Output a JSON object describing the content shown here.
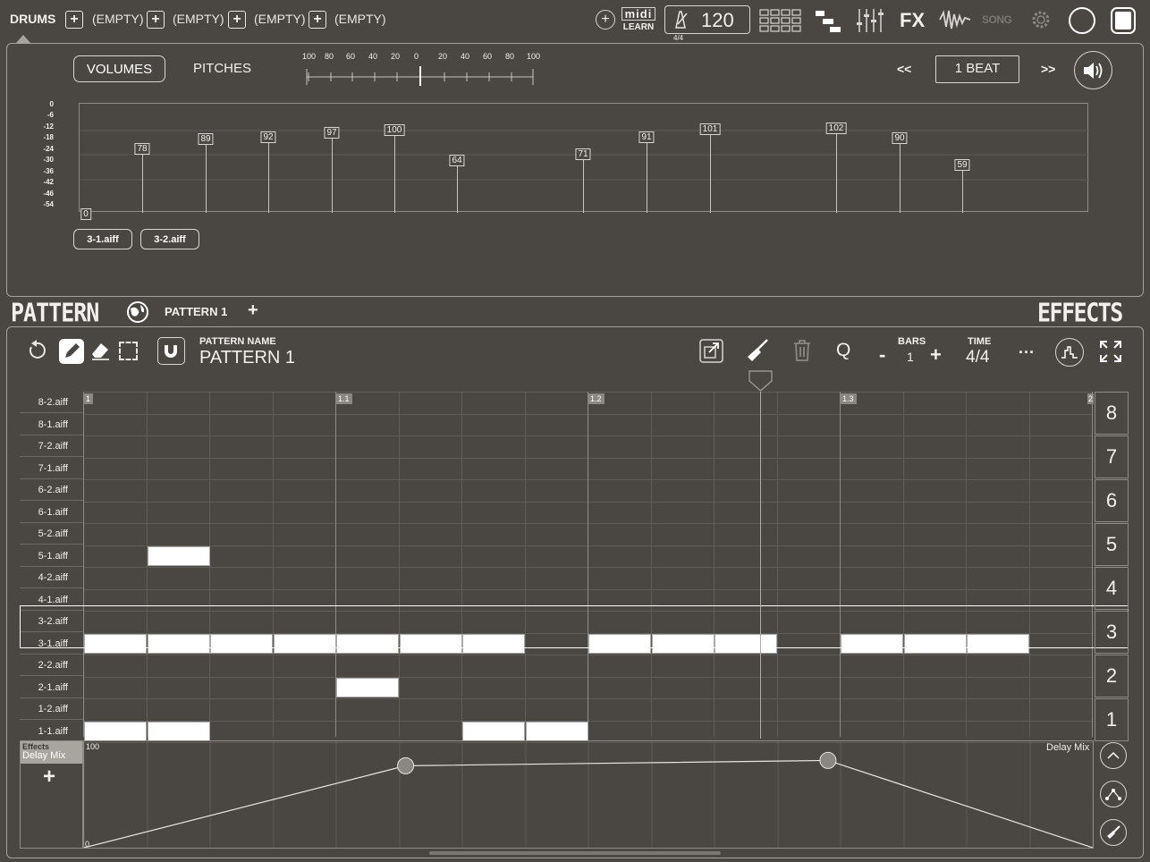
{
  "topbar": {
    "title": "DRUMS",
    "slots": [
      {
        "label": "(EMPTY)"
      },
      {
        "label": "(EMPTY)"
      },
      {
        "label": "(EMPTY)"
      },
      {
        "label": "(EMPTY)"
      }
    ],
    "midi_label": "midi",
    "learn_label": "LEARN",
    "tempo": "120",
    "time_sig_small": "4/4",
    "fx_label": "FX",
    "song_label": "SONG"
  },
  "upper_panel": {
    "tabs": [
      {
        "label": "VOLUMES"
      },
      {
        "label": "PITCHES"
      }
    ],
    "pitch_scale": [
      "100",
      "80",
      "60",
      "40",
      "20",
      "0",
      "20",
      "40",
      "60",
      "80",
      "100"
    ],
    "prev_label": "<<",
    "beat_label": "1 BEAT",
    "next_label": ">>",
    "db_ticks": [
      "0",
      "-6",
      "-12",
      "-18",
      "-24",
      "-30",
      "-36",
      "-42",
      "-46",
      "-54"
    ],
    "velocities": [
      "0",
      "78",
      "89",
      "92",
      "97",
      "100",
      "64",
      "71",
      "91",
      "101",
      "102",
      "90",
      "59"
    ],
    "samples": [
      {
        "label": "3-1.aiff"
      },
      {
        "label": "3-2.aiff"
      }
    ]
  },
  "pattern_header": {
    "title": "PATTERN",
    "pattern": "PATTERN 1",
    "effects_title": "EFFECTS"
  },
  "editor": {
    "name_caption": "PATTERN NAME",
    "name_value": "PATTERN 1",
    "bars_caption": "BARS",
    "bars_value": "1",
    "bars_minus": "-",
    "bars_plus": "+",
    "time_caption": "TIME",
    "time_value": "4/4",
    "more": "···",
    "quantize": "Q"
  },
  "grid": {
    "rows": [
      "8-2.aiff",
      "8-1.aiff",
      "7-2.aiff",
      "7-1.aiff",
      "6-2.aiff",
      "6-1.aiff",
      "5-2.aiff",
      "5-1.aiff",
      "4-2.aiff",
      "4-1.aiff",
      "3-2.aiff",
      "3-1.aiff",
      "2-2.aiff",
      "2-1.aiff",
      "1-2.aiff",
      "1-1.aiff"
    ],
    "markers": [
      "1",
      "1.1",
      "1.2",
      "1.3",
      "2"
    ],
    "pads": [
      "8",
      "7",
      "6",
      "5",
      "4",
      "3",
      "2",
      "1"
    ],
    "notes": [
      {
        "row": "5-1.aiff",
        "steps": [
          2
        ]
      },
      {
        "row": "3-1.aiff",
        "steps": [
          1,
          2,
          3,
          4,
          5,
          6,
          7,
          9,
          10,
          11,
          13,
          14,
          15
        ]
      },
      {
        "row": "2-1.aiff",
        "steps": [
          5
        ]
      },
      {
        "row": "1-1.aiff",
        "steps": [
          1,
          2,
          7,
          8
        ]
      }
    ]
  },
  "automation": {
    "effects_caption": "Effects",
    "param": "Delay Mix",
    "add": "+",
    "top_value": "100",
    "bottom_value": "0",
    "param_right": "Delay Mix",
    "points": [
      {
        "step": 0,
        "value": 0
      },
      {
        "step": 5.1,
        "value": 77
      },
      {
        "step": 11.8,
        "value": 82
      },
      {
        "step": 16,
        "value": 0
      }
    ]
  },
  "colors": {
    "bg": "#4a4641",
    "note": "#ffffff",
    "grid": "#605c56"
  }
}
